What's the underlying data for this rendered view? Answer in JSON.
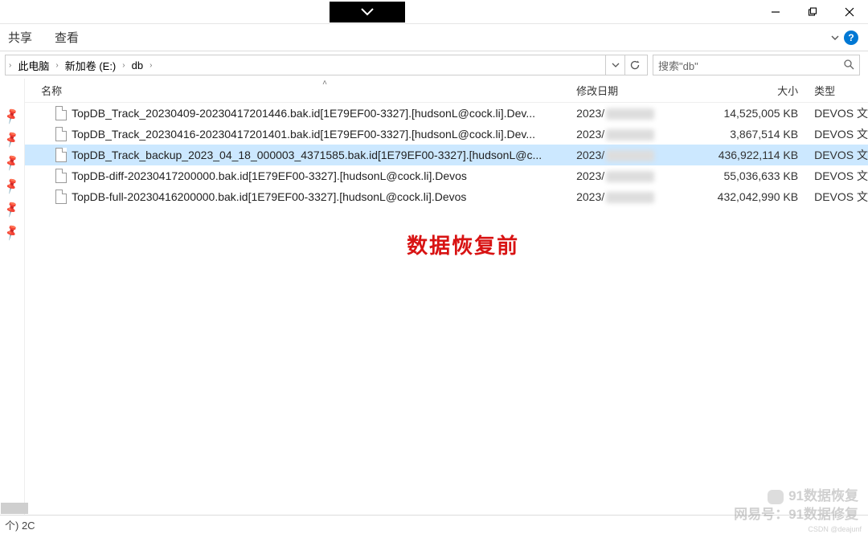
{
  "window": {
    "minimize": "—",
    "maximize": "❐",
    "close": "✕"
  },
  "ribbon": {
    "share": "共享",
    "view": "查看"
  },
  "breadcrumb": {
    "items": [
      "此电脑",
      "新加卷 (E:)",
      "db"
    ]
  },
  "search": {
    "placeholder": "搜索\"db\""
  },
  "columns": {
    "name": "名称",
    "date": "修改日期",
    "size": "大小",
    "type": "类型"
  },
  "files": [
    {
      "name": "TopDB_Track_20230409-20230417201446.bak.id[1E79EF00-3327].[hudsonL@cock.li].Dev...",
      "date_prefix": "2023/",
      "size": "14,525,005 KB",
      "type": "DEVOS 文",
      "selected": false
    },
    {
      "name": "TopDB_Track_20230416-20230417201401.bak.id[1E79EF00-3327].[hudsonL@cock.li].Dev...",
      "date_prefix": "2023/",
      "size": "3,867,514 KB",
      "type": "DEVOS 文",
      "selected": false
    },
    {
      "name": "TopDB_Track_backup_2023_04_18_000003_4371585.bak.id[1E79EF00-3327].[hudsonL@c...",
      "date_prefix": "2023/",
      "size": "436,922,114 KB",
      "type": "DEVOS 文",
      "selected": true
    },
    {
      "name": "TopDB-diff-20230417200000.bak.id[1E79EF00-3327].[hudsonL@cock.li].Devos",
      "date_prefix": "2023/",
      "size": "55,036,633 KB",
      "type": "DEVOS 文",
      "selected": false
    },
    {
      "name": "TopDB-full-20230416200000.bak.id[1E79EF00-3327].[hudsonL@cock.li].Devos",
      "date_prefix": "2023/",
      "size": "432,042,990 KB",
      "type": "DEVOS 文",
      "selected": false
    }
  ],
  "overlay": "数据恢复前",
  "status": {
    "left": "个) 2C"
  },
  "watermark": {
    "line1": "91数据恢复",
    "line2": "网易号：91数据修复"
  },
  "csdn": "CSDN @deajunf"
}
